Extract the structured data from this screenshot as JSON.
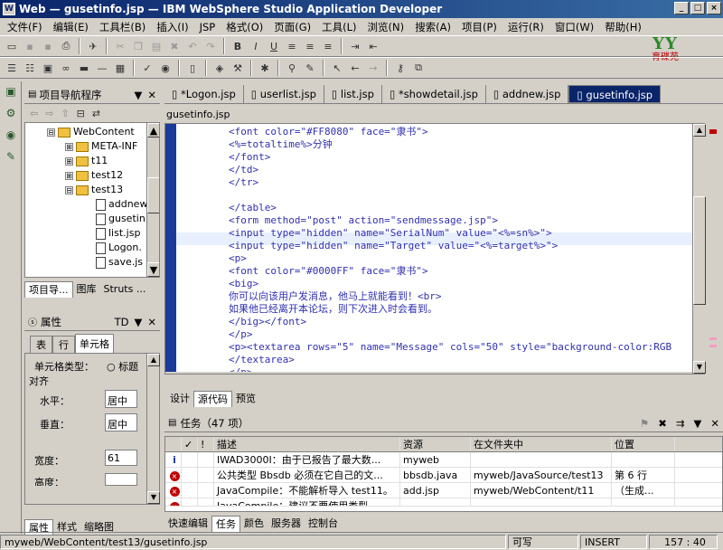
{
  "title": "Web — gusetinfo.jsp — IBM WebSphere Studio Application Developer",
  "menu": [
    "文件(F)",
    "编辑(E)",
    "工具栏(B)",
    "插入(I)",
    "JSP",
    "格式(O)",
    "页面(G)",
    "工具(L)",
    "浏览(N)",
    "搜索(A)",
    "项目(P)",
    "运行(R)",
    "窗口(W)",
    "帮助(H)"
  ],
  "logo": {
    "mark": "YY",
    "text": "育碟苑"
  },
  "navigator": {
    "title": "项目导航程序",
    "items": [
      {
        "label": "WebContent",
        "level": 0,
        "exp": "⊟",
        "type": "folder"
      },
      {
        "label": "META-INF",
        "level": 1,
        "exp": "⊞",
        "type": "folder"
      },
      {
        "label": "t11",
        "level": 1,
        "exp": "⊞",
        "type": "folder"
      },
      {
        "label": "test12",
        "level": 1,
        "exp": "⊞",
        "type": "folder"
      },
      {
        "label": "test13",
        "level": 1,
        "exp": "⊟",
        "type": "folder"
      },
      {
        "label": "addnew",
        "level": 2,
        "exp": "",
        "type": "jsp"
      },
      {
        "label": "gusetin",
        "level": 2,
        "exp": "",
        "type": "jsp"
      },
      {
        "label": "list.jsp",
        "level": 2,
        "exp": "",
        "type": "jsp"
      },
      {
        "label": "Logon.",
        "level": 2,
        "exp": "",
        "type": "jsp"
      },
      {
        "label": "save.js",
        "level": 2,
        "exp": "",
        "type": "jsp"
      }
    ],
    "tabs": [
      "项目导...",
      "图库",
      "Struts ..."
    ]
  },
  "properties": {
    "title": "属性",
    "tag": "TD",
    "tabs": [
      "表",
      "行",
      "单元格"
    ],
    "cell_type_label": "单元格类型：",
    "cell_type_option": "标题",
    "align_label": "对齐",
    "horizontal_label": "水平：",
    "horizontal_value": "居中",
    "vertical_label": "垂直：",
    "vertical_value": "居中",
    "width_label": "宽度：",
    "width_value": "61",
    "height_label": "高度：",
    "bottom_tabs": [
      "属性",
      "样式",
      "缩略图"
    ]
  },
  "editor": {
    "tabs": [
      "*Logon.jsp",
      "userlist.jsp",
      "list.jsp",
      "*showdetail.jsp",
      "addnew.jsp",
      "gusetinfo.jsp"
    ],
    "active_tab": 5,
    "file_label": "gusetinfo.jsp",
    "lines": [
      "<font color=\"#FF8080\" face=\"隶书\">",
      "<%=totaltime%>分钟",
      "</font>",
      "</td>",
      "</tr>",
      "",
      "</table>",
      "<form method=\"post\" action=\"sendmessage.jsp\">",
      "<input type=\"hidden\" name=\"SerialNum\" value=\"<%=sn%>\">",
      "<input type=\"hidden\" name=\"Target\" value=\"<%=target%>\">",
      "<p>",
      "<font color=\"#0000FF\" face=\"隶书\">",
      "<big>",
      "你可以向该用户发消息，他马上就能看到！<br>",
      "如果他已经离开本论坛，则下次进入时会看到。",
      "</big></font>",
      "</p>",
      "<p><textarea rows=\"5\" name=\"Message\" cols=\"50\" style=\"background-color:RGB",
      "</textarea>",
      "</p>"
    ],
    "bottom_tabs": [
      "设计",
      "源代码",
      "预览"
    ]
  },
  "tasks": {
    "title": "任务（47 项）",
    "columns": [
      "✓",
      "!",
      "描述",
      "资源",
      "在文件夹中",
      "位置"
    ],
    "rows": [
      {
        "icon": "info",
        "desc": "IWAD3000I：由于已报告了最大数...",
        "res": "myweb",
        "folder": "",
        "loc": ""
      },
      {
        "icon": "err",
        "desc": "公共类型 Bbsdb 必须在它自己的文...",
        "res": "bbsdb.java",
        "folder": "myweb/JavaSource/test13",
        "loc": "第 6 行"
      },
      {
        "icon": "err",
        "desc": "JavaCompile：不能解析导入 test11。",
        "res": "add.jsp",
        "folder": "myweb/WebContent/t11",
        "loc": "（生成..."
      },
      {
        "icon": "err",
        "desc": "JavaCompile：建议不要使用类型 ...",
        "res": "",
        "folder": "",
        "loc": ""
      }
    ],
    "bottom_tabs": [
      "快速编辑",
      "任务",
      "颜色",
      "服务器",
      "控制台"
    ]
  },
  "status": {
    "path": "myweb/WebContent/test13/gusetinfo.jsp",
    "writable": "可写",
    "mode": "INSERT",
    "position": "157 : 40"
  }
}
